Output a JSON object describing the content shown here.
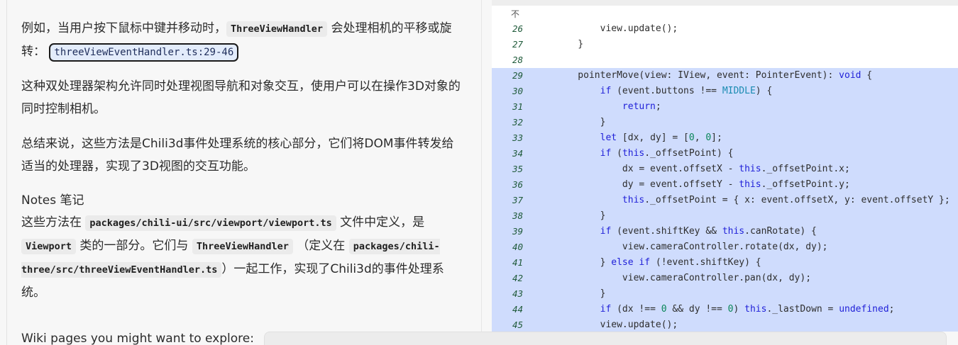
{
  "left": {
    "p1_text_a": "例如，当用户按下鼠标中键并移动时，",
    "p1_code": "ThreeViewHandler",
    "p1_text_b": " 会处理相机的平移或旋转：",
    "p1_ref": "threeViewEventHandler.ts:29-46",
    "p2": "这种双处理器架构允许同时处理视图导航和对象交互，使用户可以在操作3D对象的同时控制相机。",
    "p3": "总结来说，这些方法是Chili3d事件处理系统的核心部分，它们将DOM事件转发给适当的处理器，实现了3D视图的交互功能。",
    "notes_heading": "Notes  笔记",
    "notes": {
      "t1": "这些方法在 ",
      "c1": "packages/chili-ui/src/viewport/viewport.ts",
      "t2": " 文件中定义，是 ",
      "c2": "Viewport",
      "t3": " 类的一部分。它们与 ",
      "c3": "ThreeViewHandler",
      "t4": " （定义在 ",
      "c4": "packages/chili-three/src/threeViewEventHandler.ts",
      "t5": "）一起工作，实现了Chili3d的事件处理系统。"
    },
    "wiki_text": "Wiki pages you might want to explore:"
  },
  "code": {
    "collapse_icon": "collapse-up-arrow",
    "lines": [
      {
        "n": "26",
        "hl": false,
        "tokens": [
          [
            "",
            "        view.update();"
          ]
        ]
      },
      {
        "n": "27",
        "hl": false,
        "tokens": [
          [
            "",
            "    }"
          ]
        ]
      },
      {
        "n": "28",
        "hl": false,
        "tokens": [
          [
            "",
            ""
          ]
        ]
      },
      {
        "n": "29",
        "hl": true,
        "tokens": [
          [
            "",
            "    pointerMove(view: IView, event: PointerEvent): "
          ],
          [
            "kw",
            "void"
          ],
          [
            "",
            " {"
          ]
        ]
      },
      {
        "n": "30",
        "hl": true,
        "tokens": [
          [
            "",
            "        "
          ],
          [
            "kw",
            "if"
          ],
          [
            "",
            " (event.buttons !== "
          ],
          [
            "const",
            "MIDDLE"
          ],
          [
            "",
            ") {"
          ]
        ]
      },
      {
        "n": "31",
        "hl": true,
        "tokens": [
          [
            "",
            "            "
          ],
          [
            "kw",
            "return"
          ],
          [
            "",
            ";"
          ]
        ]
      },
      {
        "n": "32",
        "hl": true,
        "tokens": [
          [
            "",
            "        }"
          ]
        ]
      },
      {
        "n": "33",
        "hl": true,
        "tokens": [
          [
            "",
            "        "
          ],
          [
            "kw",
            "let"
          ],
          [
            "",
            " [dx, dy] = ["
          ],
          [
            "num",
            "0"
          ],
          [
            "",
            ", "
          ],
          [
            "num",
            "0"
          ],
          [
            "",
            "];"
          ]
        ]
      },
      {
        "n": "34",
        "hl": true,
        "tokens": [
          [
            "",
            "        "
          ],
          [
            "kw",
            "if"
          ],
          [
            "",
            " ("
          ],
          [
            "kw",
            "this"
          ],
          [
            "",
            "._offsetPoint) {"
          ]
        ]
      },
      {
        "n": "35",
        "hl": true,
        "tokens": [
          [
            "",
            "            dx = event.offsetX - "
          ],
          [
            "kw",
            "this"
          ],
          [
            "",
            "._offsetPoint.x;"
          ]
        ]
      },
      {
        "n": "36",
        "hl": true,
        "tokens": [
          [
            "",
            "            dy = event.offsetY - "
          ],
          [
            "kw",
            "this"
          ],
          [
            "",
            "._offsetPoint.y;"
          ]
        ]
      },
      {
        "n": "37",
        "hl": true,
        "tokens": [
          [
            "",
            "            "
          ],
          [
            "kw",
            "this"
          ],
          [
            "",
            "._offsetPoint = { x: event.offsetX, y: event.offsetY };"
          ]
        ]
      },
      {
        "n": "38",
        "hl": true,
        "tokens": [
          [
            "",
            "        }"
          ]
        ]
      },
      {
        "n": "39",
        "hl": true,
        "tokens": [
          [
            "",
            "        "
          ],
          [
            "kw",
            "if"
          ],
          [
            "",
            " (event.shiftKey && "
          ],
          [
            "kw",
            "this"
          ],
          [
            "",
            ".canRotate) {"
          ]
        ]
      },
      {
        "n": "40",
        "hl": true,
        "tokens": [
          [
            "",
            "            view.cameraController.rotate(dx, dy);"
          ]
        ]
      },
      {
        "n": "41",
        "hl": true,
        "tokens": [
          [
            "",
            "        } "
          ],
          [
            "kw",
            "else if"
          ],
          [
            "",
            " (!event.shiftKey) {"
          ]
        ]
      },
      {
        "n": "42",
        "hl": true,
        "tokens": [
          [
            "",
            "            view.cameraController.pan(dx, dy);"
          ]
        ]
      },
      {
        "n": "43",
        "hl": true,
        "tokens": [
          [
            "",
            "        }"
          ]
        ]
      },
      {
        "n": "44",
        "hl": true,
        "tokens": [
          [
            "",
            "        "
          ],
          [
            "kw",
            "if"
          ],
          [
            "",
            " (dx !== "
          ],
          [
            "num",
            "0"
          ],
          [
            "",
            " && dy !== "
          ],
          [
            "num",
            "0"
          ],
          [
            "",
            ") "
          ],
          [
            "kw",
            "this"
          ],
          [
            "",
            "._lastDown = "
          ],
          [
            "kw",
            "undefined"
          ],
          [
            "",
            ";"
          ]
        ]
      },
      {
        "n": "45",
        "hl": true,
        "tokens": [
          [
            "",
            "        view.update();"
          ]
        ]
      }
    ]
  }
}
